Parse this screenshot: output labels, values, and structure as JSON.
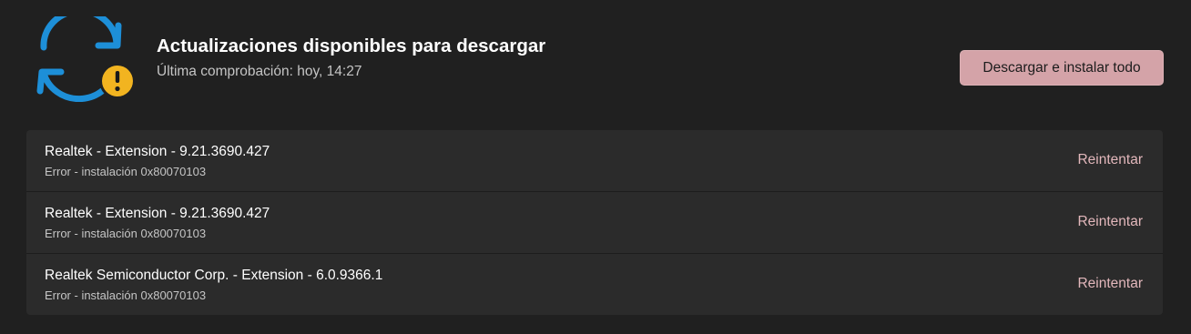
{
  "header": {
    "title": "Actualizaciones disponibles para descargar",
    "subtitle": "Última comprobación: hoy, 14:27",
    "icon": "sync-warning-icon",
    "icon_arrow_color": "#1d8fd8",
    "icon_badge_color": "#f2b420"
  },
  "actions": {
    "download_install_all_label": "Descargar e instalar todo",
    "accent_color": "#d4a3a8"
  },
  "updates": [
    {
      "name": "Realtek - Extension - 9.21.3690.427",
      "status": "Error - instalación 0x80070103",
      "action_label": "Reintentar"
    },
    {
      "name": "Realtek - Extension - 9.21.3690.427",
      "status": "Error - instalación 0x80070103",
      "action_label": "Reintentar"
    },
    {
      "name": "Realtek Semiconductor Corp. - Extension - 6.0.9366.1",
      "status": "Error - instalación 0x80070103",
      "action_label": "Reintentar"
    }
  ]
}
